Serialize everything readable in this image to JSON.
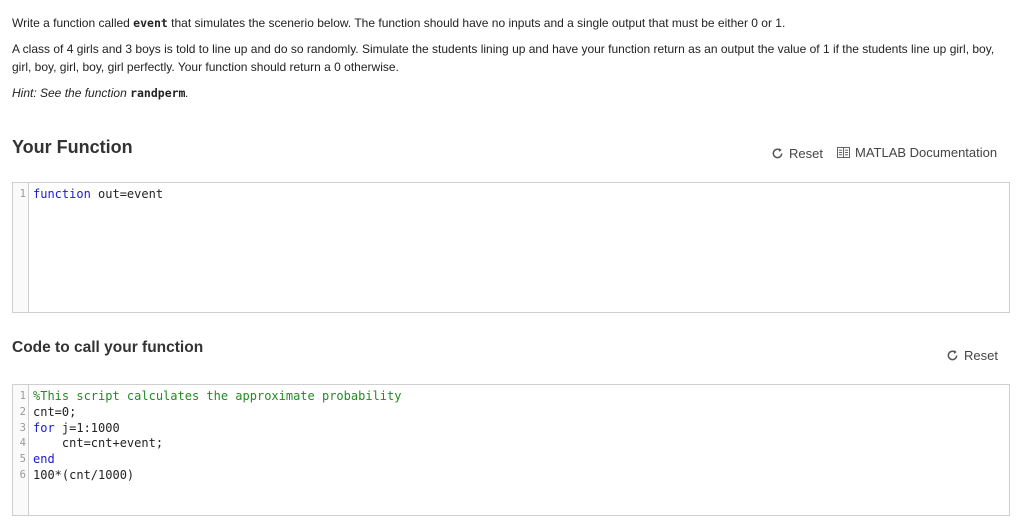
{
  "problem": {
    "line1_pre": "Write a function called ",
    "line1_code": "event",
    "line1_post": " that simulates the scenerio below. The function should have no inputs and a single output that must be either 0 or 1.",
    "paragraph": "A class of 4 girls and 3 boys is told to line up and do so randomly. Simulate the students lining up and have your function return as an output the value of 1 if the students line up girl, boy, girl, boy, girl, boy, girl perfectly.  Your function should return a 0 otherwise.",
    "hint_pre": "Hint: See the function ",
    "hint_code": "randperm",
    "hint_post": "."
  },
  "your_function": {
    "title": "Your Function",
    "reset_label": "Reset",
    "docs_label": "MATLAB Documentation",
    "code": [
      {
        "num": "1",
        "kw": "function",
        "text": " out=event"
      }
    ]
  },
  "call_code": {
    "title": "Code to call your function",
    "reset_label": "Reset",
    "code": [
      {
        "num": "1",
        "comment": "%This script calculates the approximate probability"
      },
      {
        "num": "2",
        "text": "cnt=0;"
      },
      {
        "num": "3",
        "kw": "for",
        "text": " j=1:1000"
      },
      {
        "num": "4",
        "text": "    cnt=cnt+event;"
      },
      {
        "num": "5",
        "kw": "end"
      },
      {
        "num": "6",
        "text": "100*(cnt/1000)"
      }
    ]
  },
  "colors": {
    "keyword": "#1a1ad1",
    "comment": "#228b22",
    "border": "#cfcfcf"
  },
  "icons": [
    "reset-icon",
    "documentation-icon"
  ]
}
